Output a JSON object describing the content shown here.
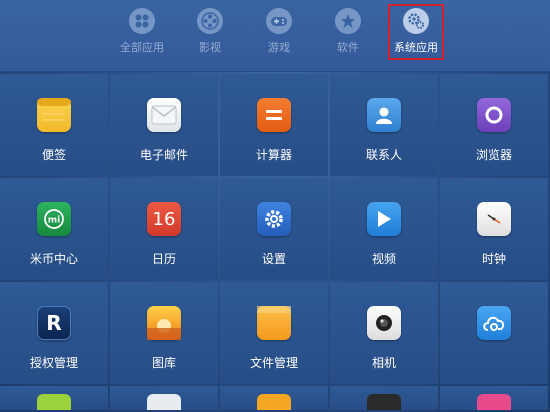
{
  "categories": [
    {
      "label": "全部应用",
      "icon": "dots-grid-icon"
    },
    {
      "label": "影视",
      "icon": "film-reel-icon"
    },
    {
      "label": "游戏",
      "icon": "gamepad-icon"
    },
    {
      "label": "软件",
      "icon": "star-icon"
    },
    {
      "label": "系统应用",
      "icon": "gears-icon",
      "selected": true
    }
  ],
  "apps": [
    {
      "label": "便签",
      "icon": "notes-icon",
      "color": "#f4c234"
    },
    {
      "label": "电子邮件",
      "icon": "envelope-icon",
      "color": "#e9edf2"
    },
    {
      "label": "计算器",
      "icon": "calculator-icon",
      "color": "#ee6a1f"
    },
    {
      "label": "联系人",
      "icon": "contacts-icon",
      "color": "#3f93d9"
    },
    {
      "label": "浏览器",
      "icon": "browser-icon",
      "color": "#7a4fc9"
    },
    {
      "label": "米币中心",
      "icon": "mi-coin-icon",
      "color": "#1f9d4c"
    },
    {
      "label": "日历",
      "icon": "calendar-icon",
      "color": "#e04a36"
    },
    {
      "label": "设置",
      "icon": "settings-gear-icon",
      "color": "#2f6fcf"
    },
    {
      "label": "视频",
      "icon": "play-icon",
      "color": "#2b8ee6"
    },
    {
      "label": "时钟",
      "icon": "clock-icon",
      "color": "#eeeeee"
    },
    {
      "label": "授权管理",
      "icon": "r-shield-icon",
      "color": "#12315e"
    },
    {
      "label": "图库",
      "icon": "gallery-icon",
      "color": "#f0a028"
    },
    {
      "label": "文件管理",
      "icon": "folder-icon",
      "color": "#f5a623"
    },
    {
      "label": "相机",
      "icon": "camera-icon",
      "color": "#f2f2f2"
    },
    {
      "label": "",
      "icon": "cloud-icon",
      "color": "#2c8fe0"
    }
  ],
  "calendar_day": "16"
}
